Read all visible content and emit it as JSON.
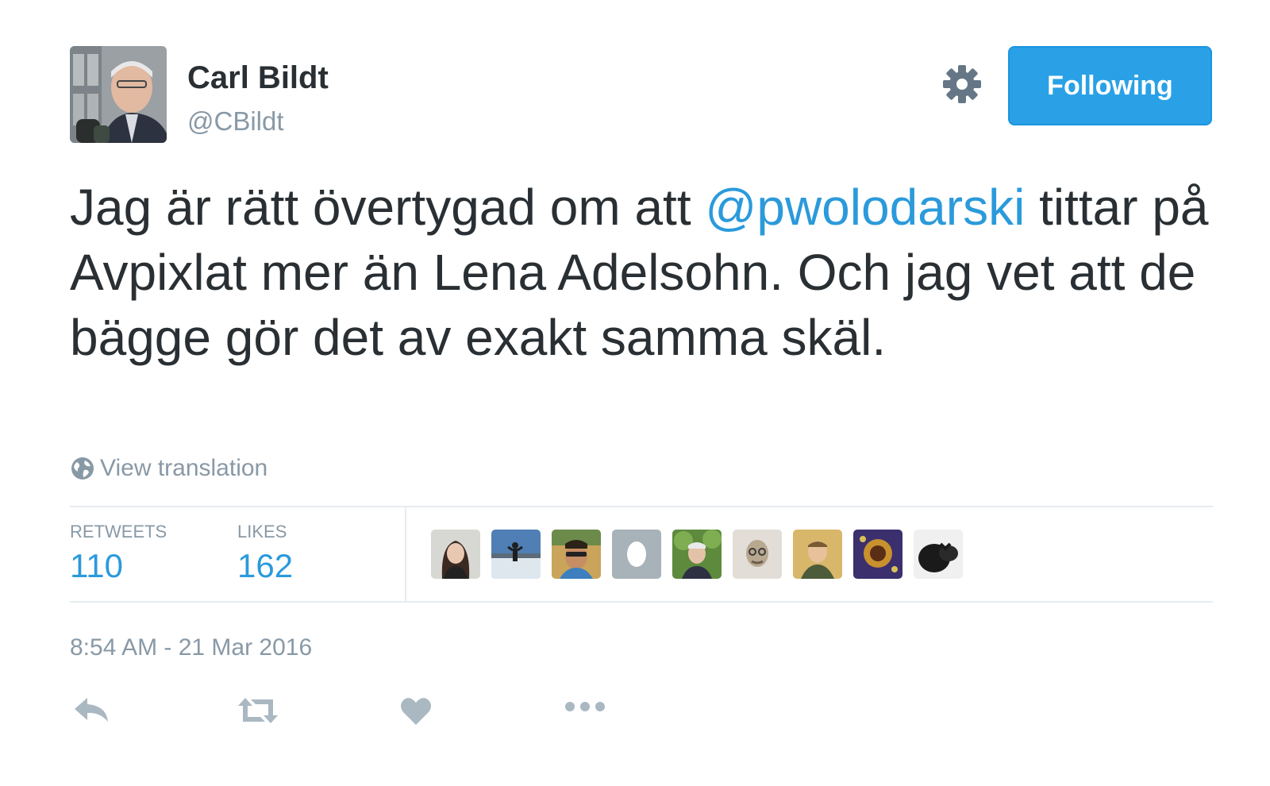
{
  "author": {
    "name": "Carl Bildt",
    "handle": "@CBildt"
  },
  "follow_button": {
    "label": "Following"
  },
  "tweet": {
    "text_before": "Jag är rätt övertygad om att ",
    "mention": "@pwolodarski",
    "text_after": " tittar på Avpixlat mer än Lena Adelsohn. Och jag vet att de bägge gör det av exakt samma skäl."
  },
  "translation": {
    "label": "View translation"
  },
  "stats": {
    "retweets_label": "RETWEETS",
    "retweets_value": "110",
    "likes_label": "LIKES",
    "likes_value": "162"
  },
  "timestamp": "8:54 AM - 21 Mar 2016",
  "icons": {
    "gear": "gear-icon",
    "globe": "globe-icon",
    "reply": "reply-icon",
    "retweet": "retweet-icon",
    "like": "heart-icon",
    "more": "more-icon"
  },
  "colors": {
    "accent": "#2aa1e6",
    "link": "#2b9adb",
    "muted": "#8899a6",
    "text": "#292f33"
  }
}
